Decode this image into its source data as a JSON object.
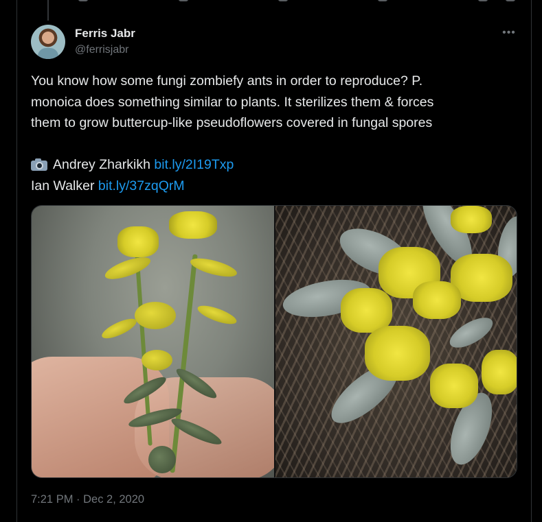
{
  "author": {
    "name": "Ferris Jabr",
    "handle": "@ferrisjabr"
  },
  "more_label": "•••",
  "tweet": {
    "line1": "You know how some fungi zombiefy ants in order to reproduce? P.",
    "line2": "monoica does something similar to plants. It sterilizes them & forces",
    "line3": "them to grow buttercup-like pseudoflowers covered in fungal spores",
    "credit1_name": "Andrey Zharkikh",
    "credit1_link": "bit.ly/2I19Txp",
    "credit2_name": "Ian Walker",
    "credit2_link": "bit.ly/37zqQrM"
  },
  "timestamp": "7:21 PM · Dec 2, 2020",
  "colors": {
    "background": "#000000",
    "text": "#e7e9ea",
    "muted": "#71767b",
    "link": "#1d9bf0"
  },
  "icons": [
    "camera-icon",
    "more-icon"
  ]
}
